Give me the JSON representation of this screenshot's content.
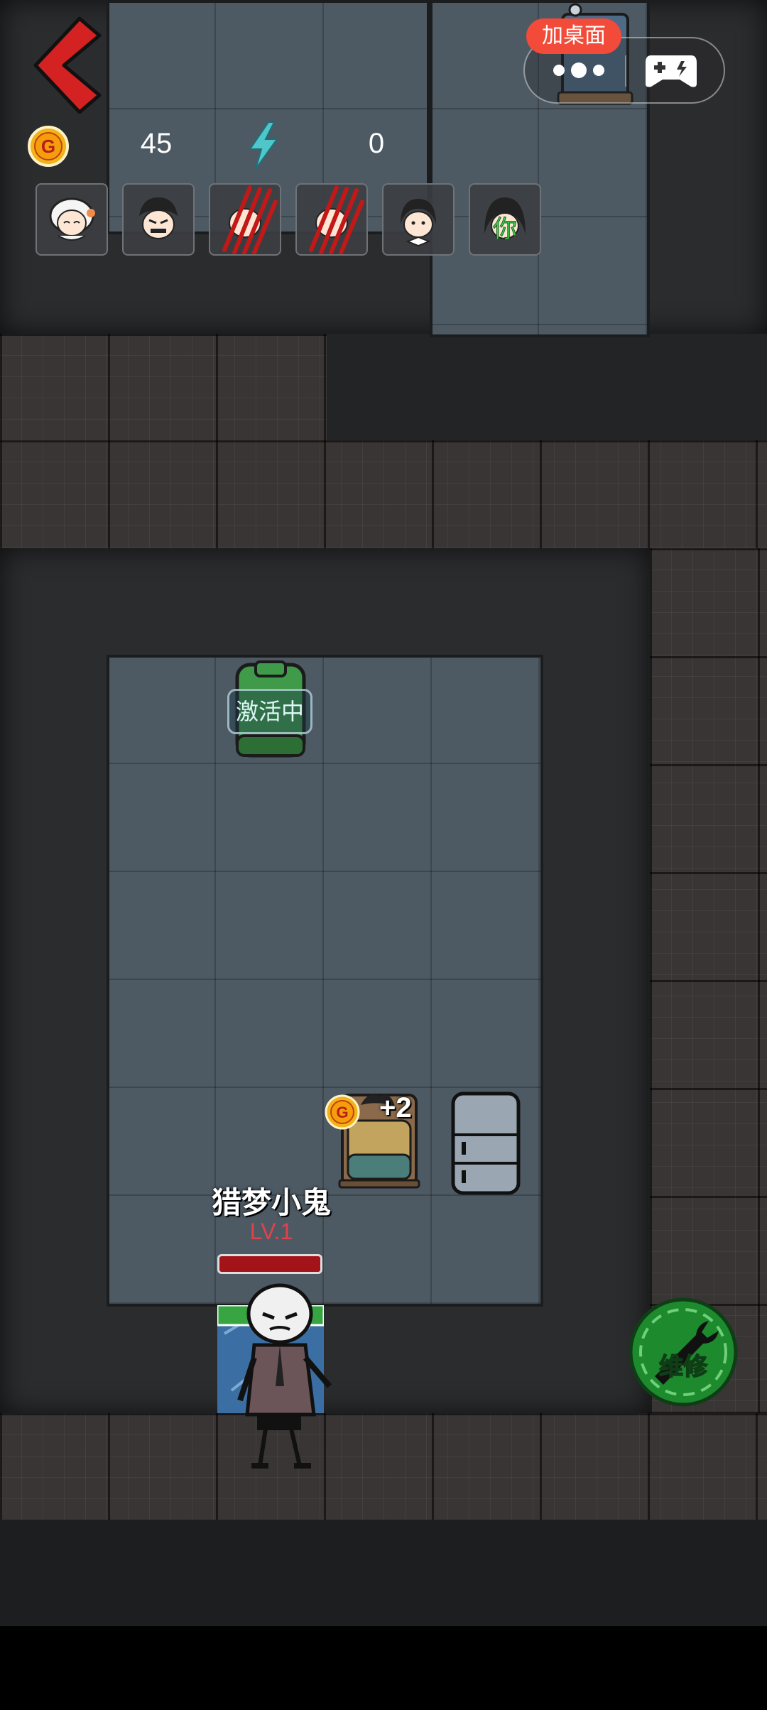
{
  "top_bar": {
    "add_desktop_label": "加桌面"
  },
  "resources": {
    "coin_icon_text": "G",
    "coins": "45",
    "energy": "0"
  },
  "roster": [
    {
      "name": "grandma-ghost-icon"
    },
    {
      "name": "angry-man-icon"
    },
    {
      "name": "clawed-slot-icon"
    },
    {
      "name": "clawed-slot-icon"
    },
    {
      "name": "girl-bow-icon"
    },
    {
      "name": "you-player-icon",
      "label": "你"
    }
  ],
  "room": {
    "active_label": "激活中",
    "coin_gain": "+2",
    "coin_icon_text": "G"
  },
  "ghost": {
    "name": "猎梦小鬼",
    "level": "LV.1"
  },
  "repair": {
    "label": "维修"
  },
  "colors": {
    "accent_red": "#f24b3a",
    "back_arrow": "#d42121",
    "repair_green": "#1e8a2e",
    "coin_gold": "#f2b21a",
    "energy_teal": "#4fc6c9"
  }
}
